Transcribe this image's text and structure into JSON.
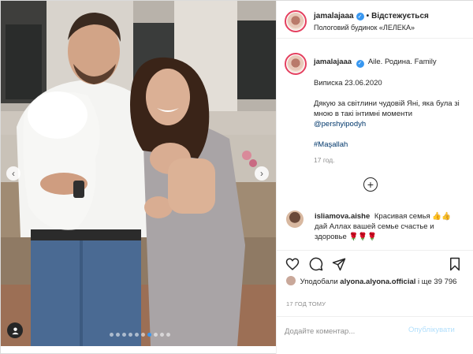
{
  "post": {
    "username": "jamalajaaa",
    "follow_state": "Відстежується",
    "location": "Пологовий будинок «ЛЕЛЕКА»",
    "caption": {
      "username": "jamalajaaa",
      "line1": "Aile. Родина. Family",
      "line2": "Виписка 23.06.2020",
      "line3": "Дякую за світлини чудовій Яні, яка була зі мною в такі інтимні моменти",
      "mention": "@pershyipodyh",
      "hashtag": "#Maşallah",
      "time": "17 год."
    },
    "comment": {
      "username": "isliamova.aishe",
      "text": "Красивая семья 👍👍дай Аллах вашей семье счастье и здоровье 🌹🌹🌹"
    },
    "likes": {
      "prefix": "Уподобали",
      "liker": "alyona.alyona.official",
      "suffix": "і ще 39 796"
    },
    "post_age": "17 ГОД ТОМУ",
    "comment_placeholder": "Додайте коментар...",
    "publish_label": "Опублікувати",
    "carousel": {
      "count": 10,
      "active_index": 6
    }
  },
  "icons": [
    "verified-badge-icon",
    "plus-circle-icon",
    "heart-icon",
    "comment-icon",
    "share-icon",
    "bookmark-icon",
    "user-tag-icon",
    "chevron-left-icon",
    "chevron-right-icon"
  ],
  "colors": {
    "accent": "#3897f0",
    "link": "#00376b",
    "muted": "#8e8e8e",
    "story_ring": "#e4405f"
  }
}
